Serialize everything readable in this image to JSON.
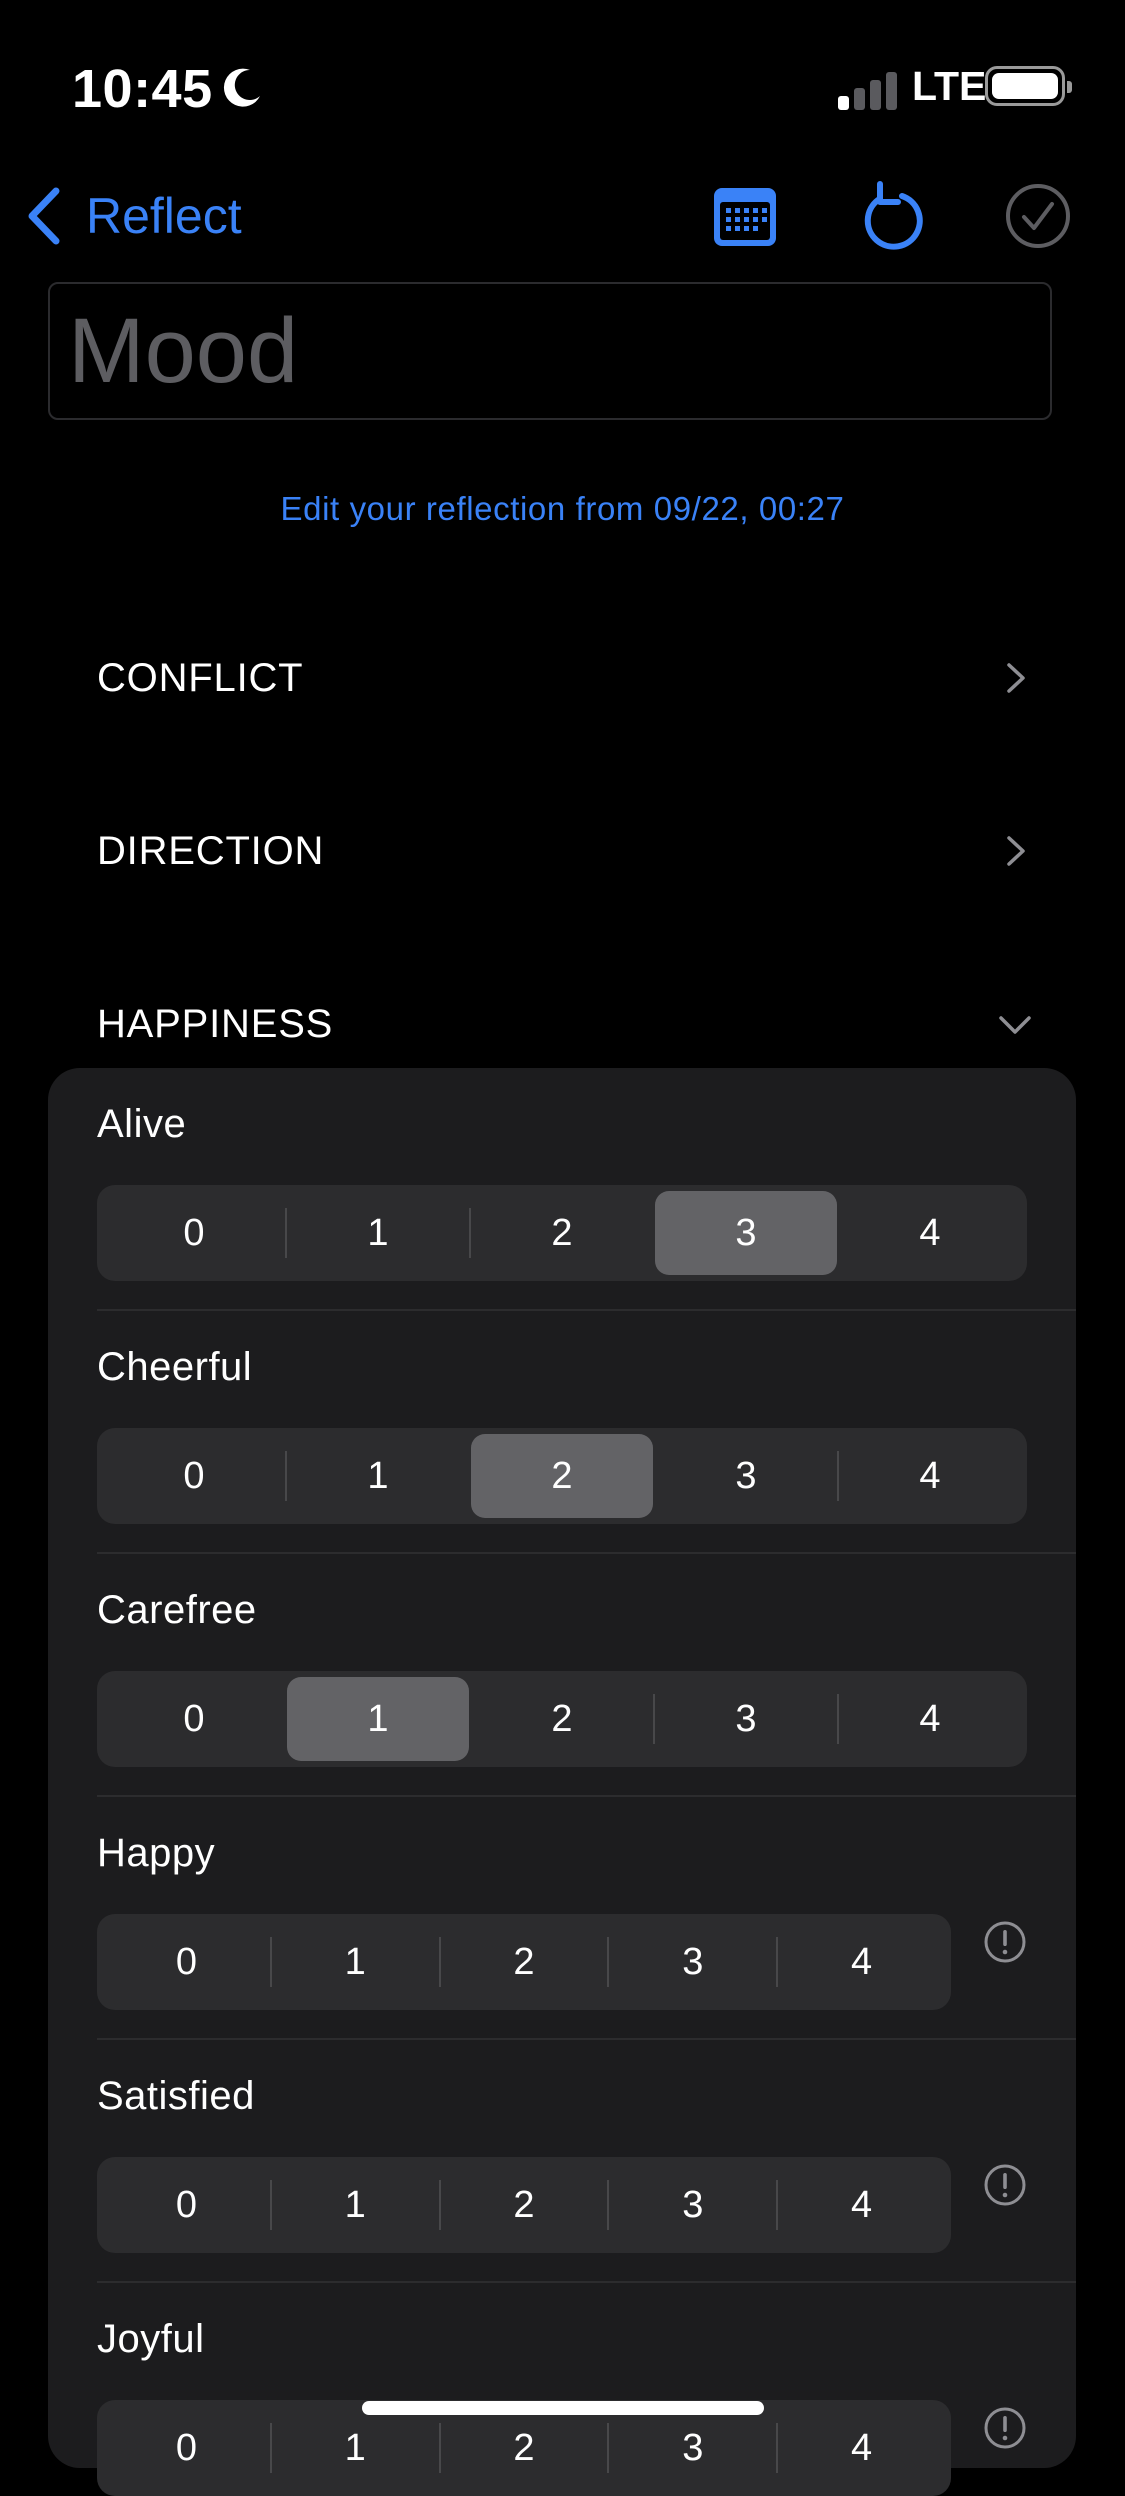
{
  "status_bar": {
    "time": "10:45",
    "network": "LTE",
    "moon_icon": "moon-icon",
    "signal_icon": "signal-bars-icon",
    "battery_icon": "battery-icon"
  },
  "nav": {
    "back_label": "Reflect",
    "back_icon": "chevron-left-icon",
    "calendar_icon": "calendar-icon",
    "undo_icon": "undo-arrow-icon",
    "confirm_icon": "checkmark-circle-icon",
    "accent_color": "#3a82f7"
  },
  "title_field": {
    "placeholder": "Mood",
    "value": ""
  },
  "subtitle": "Edit your reflection from 09/22, 00:27",
  "sections": [
    {
      "label": "CONFLICT",
      "state": "collapsed",
      "icon": "chevron-right-icon"
    },
    {
      "label": "DIRECTION",
      "state": "collapsed",
      "icon": "chevron-right-icon"
    },
    {
      "label": "HAPPINESS",
      "state": "expanded",
      "icon": "chevron-down-icon"
    }
  ],
  "happiness_items": [
    {
      "label": "Alive",
      "options": [
        "0",
        "1",
        "2",
        "3",
        "4"
      ],
      "selected": "3",
      "warning": false
    },
    {
      "label": "Cheerful",
      "options": [
        "0",
        "1",
        "2",
        "3",
        "4"
      ],
      "selected": "2",
      "warning": false
    },
    {
      "label": "Carefree",
      "options": [
        "0",
        "1",
        "2",
        "3",
        "4"
      ],
      "selected": "1",
      "warning": false
    },
    {
      "label": "Happy",
      "options": [
        "0",
        "1",
        "2",
        "3",
        "4"
      ],
      "selected": null,
      "warning": true,
      "warning_icon": "exclamation-circle-icon"
    },
    {
      "label": "Satisfied",
      "options": [
        "0",
        "1",
        "2",
        "3",
        "4"
      ],
      "selected": null,
      "warning": true,
      "warning_icon": "exclamation-circle-icon"
    },
    {
      "label": "Joyful",
      "options": [
        "0",
        "1",
        "2",
        "3",
        "4"
      ],
      "selected": null,
      "warning": true,
      "warning_icon": "exclamation-circle-icon"
    }
  ]
}
